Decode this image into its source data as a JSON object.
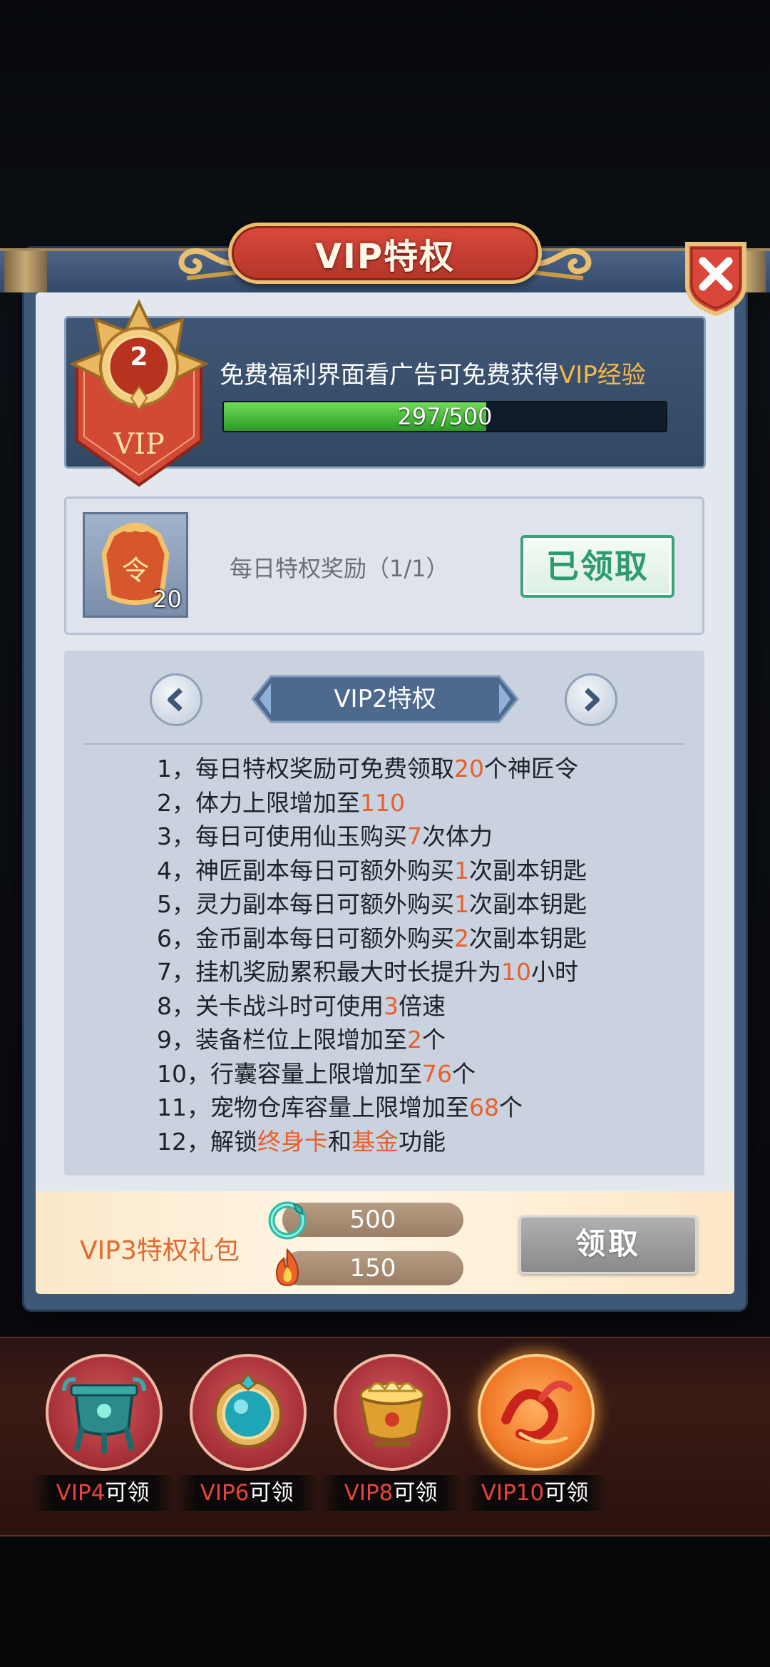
{
  "dialog": {
    "title": "VIP特权"
  },
  "vip_status": {
    "level": "2",
    "badge_label": "VIP",
    "desc_prefix": "免费福利界面看广告可免费获得",
    "desc_highlight": "VIP经验",
    "exp_text": "297/500",
    "exp_current": 297,
    "exp_max": 500
  },
  "daily_reward": {
    "item_count": "20",
    "label": "每日特权奖励（1/1）",
    "claimed_label": "已领取"
  },
  "privileges": {
    "tier_title": "VIP2特权",
    "items": [
      {
        "idx": "1，",
        "pre": "每日特权奖励可免费领取",
        "num": "20",
        "post": "个神匠令"
      },
      {
        "idx": "2，",
        "pre": "体力上限增加至",
        "num": "110",
        "post": ""
      },
      {
        "idx": "3，",
        "pre": "每日可使用仙玉购买",
        "num": "7",
        "post": "次体力"
      },
      {
        "idx": "4，",
        "pre": "神匠副本每日可额外购买",
        "num": "1",
        "post": "次副本钥匙"
      },
      {
        "idx": "5，",
        "pre": "灵力副本每日可额外购买",
        "num": "1",
        "post": "次副本钥匙"
      },
      {
        "idx": "6，",
        "pre": "金币副本每日可额外购买",
        "num": "2",
        "post": "次副本钥匙"
      },
      {
        "idx": "7，",
        "pre": "挂机奖励累积最大时长提升为",
        "num": "10",
        "post": "小时"
      },
      {
        "idx": "8，",
        "pre": "关卡战斗时可使用",
        "num": "3",
        "post": "倍速"
      },
      {
        "idx": "9，",
        "pre": "装备栏位上限增加至",
        "num": "2",
        "post": "个"
      },
      {
        "idx": "10，",
        "pre": "行囊容量上限增加至",
        "num": "76",
        "post": "个"
      },
      {
        "idx": "11，",
        "pre": "宠物仓库容量上限增加至",
        "num": "68",
        "post": "个"
      },
      {
        "idx": "12，",
        "pre": "解锁",
        "num": "终身卡",
        "mid": "和",
        "num2": "基金",
        "post": "功能"
      }
    ]
  },
  "gift_pack": {
    "label_vip": "VIP3",
    "label_rest": "特权礼包",
    "jade_amount": "500",
    "fire_amount": "150",
    "claim_label": "领取"
  },
  "milestones": [
    {
      "vip": "VIP4",
      "suffix": "可领",
      "icon": "bronze-cauldron-icon"
    },
    {
      "vip": "VIP6",
      "suffix": "可领",
      "icon": "jade-mirror-icon"
    },
    {
      "vip": "VIP8",
      "suffix": "可领",
      "icon": "treasure-bowl-icon"
    },
    {
      "vip": "VIP10",
      "suffix": "可领",
      "icon": "red-ribbon-icon"
    }
  ],
  "colors": {
    "accent_orange": "#e8602c",
    "exp_green": "#3fb335",
    "claimed_green": "#2e9b6f",
    "title_red": "#c23e30",
    "highlight_gold": "#f7b843"
  }
}
